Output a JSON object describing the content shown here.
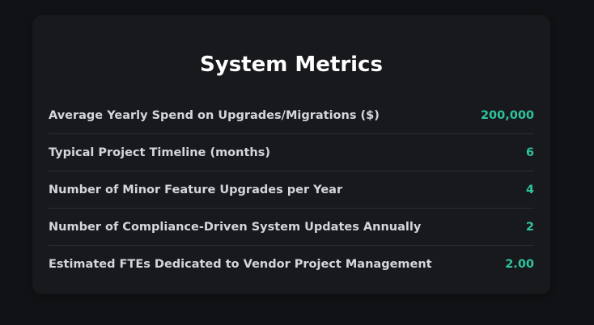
{
  "card": {
    "title": "System Metrics",
    "metrics": [
      {
        "label": "Average Yearly Spend on Upgrades/Migrations ($)",
        "value": "200,000"
      },
      {
        "label": "Typical Project Timeline (months)",
        "value": "6"
      },
      {
        "label": "Number of Minor Feature Upgrades per Year",
        "value": "4"
      },
      {
        "label": "Number of Compliance-Driven System Updates Annually",
        "value": "2"
      },
      {
        "label": "Estimated FTEs Dedicated to Vendor Project Management",
        "value": "2.00"
      }
    ]
  },
  "colors": {
    "background": "#111215",
    "card": "#18191d",
    "label": "#d4d6da",
    "value": "#2ec4a0",
    "divider": "#2a2c31"
  }
}
